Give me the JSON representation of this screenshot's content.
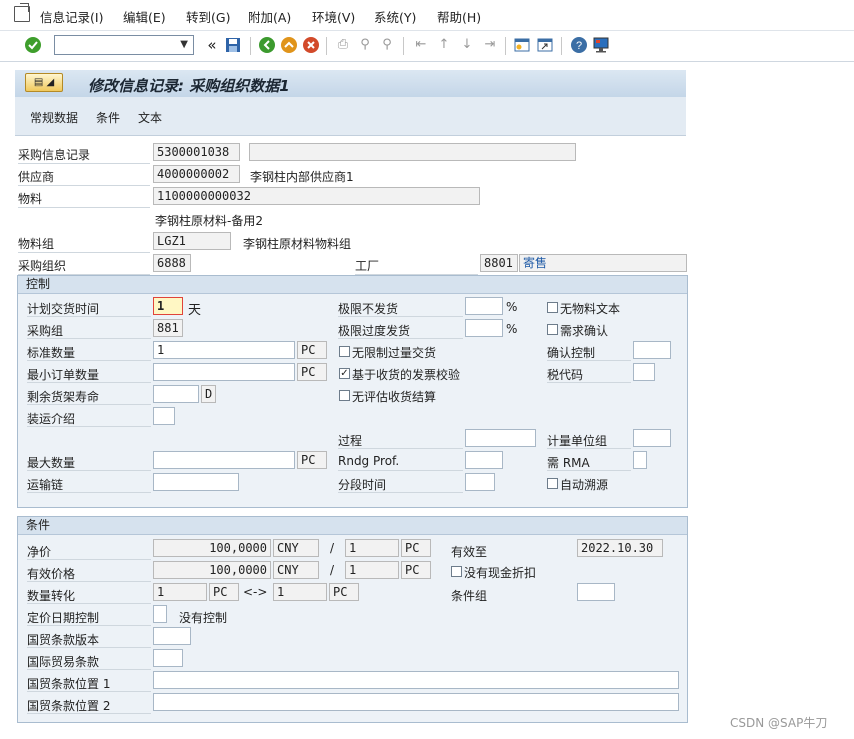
{
  "menubar": {
    "items": [
      "信息记录(I)",
      "编辑(E)",
      "转到(G)",
      "附加(A)",
      "环境(V)",
      "系统(Y)",
      "帮助(H)"
    ]
  },
  "toolbar": {
    "command_value": "",
    "icons": [
      "enter-check-icon",
      "save-icon",
      "back-icon",
      "exit-icon",
      "cancel-icon",
      "print-icon",
      "find-icon",
      "find-next-icon",
      "first-page-icon",
      "prev-page-icon",
      "next-page-icon",
      "last-page-icon",
      "create-session-icon",
      "shortcut-icon",
      "help-icon",
      "customize-layout-icon"
    ]
  },
  "title": "修改信息记录: 采购组织数据1",
  "app_toolbar": [
    "常规数据",
    "条件",
    "文本"
  ],
  "header": {
    "info_record_label": "采购信息记录",
    "info_record_value": "5300001038",
    "vendor_label": "供应商",
    "vendor_value": "4000000002",
    "vendor_name": "李钢柱内部供应商1",
    "material_label": "物料",
    "material_value": "1100000000032",
    "material_desc": "李钢柱原材料-备用2",
    "matgroup_label": "物料组",
    "matgroup_value": "LGZ1",
    "matgroup_desc": "李钢柱原材料物料组",
    "purch_org_label": "采购组织",
    "purch_org_value": "6888",
    "plant_label": "工厂",
    "plant_value": "8801",
    "plant_desc": "寄售"
  },
  "control": {
    "title": "控制",
    "planned_delivery_label": "计划交货时间",
    "planned_delivery_value": "1",
    "planned_delivery_unit": "天",
    "purch_group_label": "采购组",
    "purch_group_value": "881",
    "std_qty_label": "标准数量",
    "std_qty_value": "1",
    "std_qty_unit": "PC",
    "min_order_label": "最小订单数量",
    "min_order_value": "",
    "min_order_unit": "PC",
    "shelf_life_label": "剩余货架寿命",
    "shelf_life_unit": "D",
    "shipping_label": "装运介绍",
    "max_qty_label": "最大数量",
    "max_qty_unit": "PC",
    "ship_chain_label": "运输链",
    "underdel_label": "极限不发货",
    "overdel_label": "极限过度发货",
    "percent": "%",
    "unlimited_label": "无限制过量交货",
    "gr_based_label": "基于收货的发票校验",
    "no_ers_label": "无评估收货结算",
    "process_label": "过程",
    "rndg_label": "Rndg Prof.",
    "period_label": "分段时间",
    "no_mat_text_label": "无物料文本",
    "ack_req_label": "需求确认",
    "conf_ctrl_label": "确认控制",
    "tax_code_label": "税代码",
    "uom_group_label": "计量单位组",
    "rma_label": "需 RMA",
    "auto_source_label": "自动溯源",
    "gr_based_checked": "✓"
  },
  "conditions": {
    "title": "条件",
    "net_price_label": "净价",
    "net_price_value": "100,0000",
    "currency": "CNY",
    "slash": "/",
    "per_qty": "1",
    "per_unit": "PC",
    "valid_to_label": "有效至",
    "valid_to_value": "2022.10.30",
    "eff_price_label": "有效价格",
    "eff_price_value": "100,0000",
    "eff_currency": "CNY",
    "eff_per_qty": "1",
    "eff_per_unit": "PC",
    "no_cash_disc_label": "没有现金折扣",
    "qty_conv_label": "数量转化",
    "conv_qty1": "1",
    "conv_unit1": "PC",
    "conv_arrow": "<->",
    "conv_qty2": "1",
    "conv_unit2": "PC",
    "cond_group_label": "条件组",
    "price_date_label": "定价日期控制",
    "price_date_desc": "没有控制",
    "inco_version_label": "国贸条款版本",
    "inco_label": "国际贸易条款",
    "inco_loc1_label": "国贸条款位置 1",
    "inco_loc2_label": "国贸条款位置 2"
  },
  "watermark": "CSDN @SAP牛刀"
}
